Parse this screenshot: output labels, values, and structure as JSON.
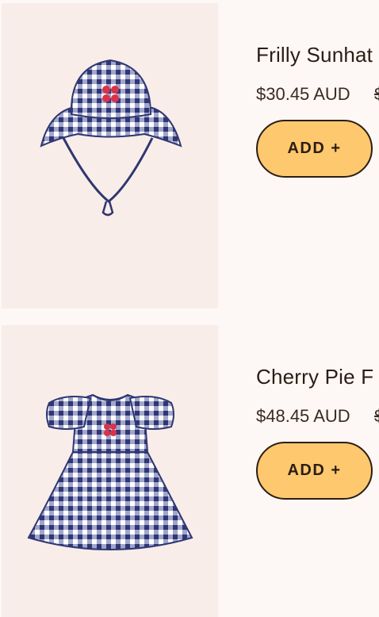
{
  "products": [
    {
      "title": "Frilly Sunhat",
      "price": "$30.45 AUD",
      "compare_price": "$",
      "add_label": "ADD +",
      "image_icon": "gingham-sunhat-image"
    },
    {
      "title": "Cherry Pie F",
      "price": "$48.45 AUD",
      "compare_price": "$",
      "add_label": "ADD +",
      "image_icon": "gingham-dress-image"
    }
  ],
  "colors": {
    "card_bg": "#f8ede8",
    "page_bg": "#fdf8f5",
    "button_bg": "#fec86e",
    "text": "#2b1d14",
    "gingham_navy": "#2f3672",
    "cherry_red": "#d8334a"
  }
}
